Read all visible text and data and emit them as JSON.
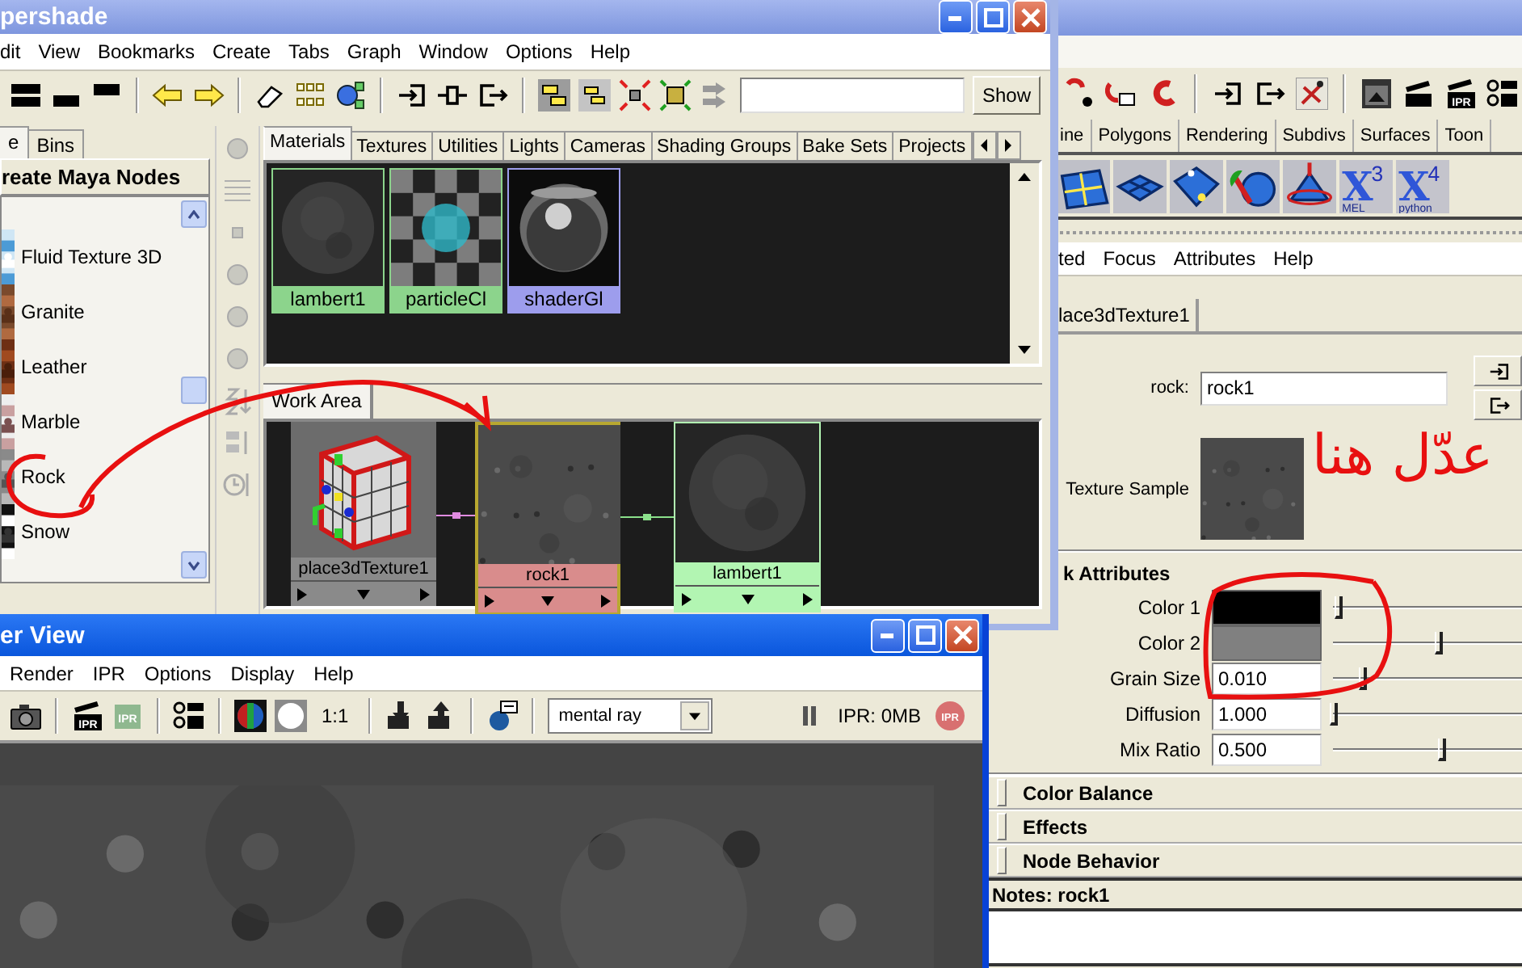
{
  "main_window": {
    "toolbar": [
      {
        "kind": "magnet-dot"
      },
      {
        "kind": "magnet-grid"
      },
      {
        "kind": "magnet"
      },
      {
        "kind": "separator"
      },
      {
        "kind": "input"
      },
      {
        "kind": "output"
      },
      {
        "kind": "history"
      },
      {
        "kind": "separator"
      },
      {
        "kind": "render-frame"
      },
      {
        "kind": "clapboard"
      },
      {
        "kind": "clapboard-text",
        "text": "IPR"
      },
      {
        "kind": "render-settings"
      }
    ],
    "shelf_tabs": [
      "ine",
      "Polygons",
      "Rendering",
      "Subdivs",
      "Surfaces",
      "Toon"
    ],
    "shelf": [
      {
        "kind": "grid-plane"
      },
      {
        "kind": "plane"
      },
      {
        "kind": "plane-points"
      },
      {
        "kind": "sphere-arrow"
      },
      {
        "kind": "cone"
      },
      {
        "kind": "script",
        "letter": "X",
        "sup": "3",
        "sub": "MEL"
      },
      {
        "kind": "script",
        "letter": "X",
        "sup": "4",
        "sub": "python"
      }
    ]
  },
  "attribute_editor": {
    "menu": [
      "ted",
      "Focus",
      "Attributes",
      "Help"
    ],
    "tab": "lace3dTexture1",
    "name_label": "rock:",
    "name_value": "rock1",
    "sample_label": "Texture Sample",
    "section": "k Attributes",
    "attributes": [
      {
        "kind": "color",
        "label": "Color 1",
        "color": "#000000",
        "level": 0.02
      },
      {
        "kind": "color",
        "label": "Color 2",
        "color": "#808080",
        "level": 0.5
      },
      {
        "kind": "number",
        "label": "Grain Size",
        "value": "0.010",
        "level": 0.14
      },
      {
        "kind": "number",
        "label": "Diffusion",
        "value": "1.000",
        "level": 0.0
      },
      {
        "kind": "number",
        "label": "Mix Ratio",
        "value": "0.500",
        "level": 0.52
      }
    ],
    "collapsed_sections": [
      "Color Balance",
      "Effects",
      "Node Behavior"
    ],
    "notes": "Notes:  rock1"
  },
  "hypershade": {
    "title": "pershade",
    "menu": [
      "dit",
      "View",
      "Bookmarks",
      "Create",
      "Tabs",
      "Graph",
      "Window",
      "Options",
      "Help"
    ],
    "toolbar": [
      {
        "kind": "layout-a"
      },
      {
        "kind": "layout-b"
      },
      {
        "kind": "layout-c"
      },
      {
        "kind": "separator"
      },
      {
        "kind": "arrow-left"
      },
      {
        "kind": "arrow-right"
      },
      {
        "kind": "separator"
      },
      {
        "kind": "eraser"
      },
      {
        "kind": "node-grid"
      },
      {
        "kind": "network"
      },
      {
        "kind": "separator"
      },
      {
        "kind": "input"
      },
      {
        "kind": "input-output"
      },
      {
        "kind": "output"
      },
      {
        "kind": "separator"
      },
      {
        "kind": "toggle"
      },
      {
        "kind": "toggle-small"
      },
      {
        "kind": "collapse"
      },
      {
        "kind": "expand"
      },
      {
        "kind": "fan"
      },
      {
        "kind": "field"
      },
      {
        "kind": "button",
        "label": "Show"
      }
    ],
    "left_tabs": [
      {
        "label": "e",
        "selected": true
      },
      {
        "label": "Bins",
        "selected": false
      }
    ],
    "panel_title": "reate Maya Nodes",
    "nodes": [
      "Fluid Texture 3D",
      "Granite",
      "Leather",
      "Marble",
      "Rock",
      "Snow"
    ],
    "side_tools": [
      {
        "kind": "sphere-small"
      },
      {
        "kind": "grid"
      },
      {
        "kind": "dot"
      },
      {
        "kind": "sphere-small"
      },
      {
        "kind": "sphere-small"
      },
      {
        "kind": "sphere-small"
      },
      {
        "kind": "sort-az"
      },
      {
        "kind": "sort-type"
      },
      {
        "kind": "sort-time"
      }
    ],
    "tabs": [
      {
        "label": "Materials",
        "selected": true
      },
      {
        "label": "Textures",
        "selected": false
      },
      {
        "label": "Utilities",
        "selected": false
      },
      {
        "label": "Lights",
        "selected": false
      },
      {
        "label": "Cameras",
        "selected": false
      },
      {
        "label": "Shading Groups",
        "selected": false
      },
      {
        "label": "Bake Sets",
        "selected": false
      },
      {
        "label": "Projects",
        "selected": false
      }
    ],
    "swatches": [
      {
        "label": "lambert1",
        "kind": "lambert"
      },
      {
        "label": "particleCl",
        "kind": "particle"
      },
      {
        "label": "shaderGl",
        "kind": "glow"
      }
    ],
    "work_area": {
      "tab": "Work Area",
      "nodes": [
        {
          "label": "place3dTexture1",
          "kind": "place3d"
        },
        {
          "label": "rock1",
          "kind": "texture"
        },
        {
          "label": "lambert1",
          "kind": "material"
        }
      ]
    }
  },
  "render_view": {
    "title": "er View",
    "menu": [
      "Render",
      "IPR",
      "Options",
      "Display",
      "Help"
    ],
    "toolbar": [
      {
        "kind": "camera"
      },
      {
        "kind": "separator"
      },
      {
        "kind": "clapboard-text",
        "text": "IPR"
      },
      {
        "kind": "ipr-green",
        "text": "IPR"
      },
      {
        "kind": "separator"
      },
      {
        "kind": "render-settings"
      },
      {
        "kind": "separator"
      },
      {
        "kind": "rgb"
      },
      {
        "kind": "circle"
      },
      {
        "kind": "text",
        "text": "1:1"
      },
      {
        "kind": "separator"
      },
      {
        "kind": "down"
      },
      {
        "kind": "up"
      },
      {
        "kind": "separator"
      },
      {
        "kind": "log"
      },
      {
        "kind": "separator"
      },
      {
        "kind": "dropdown",
        "value": "mental ray"
      }
    ],
    "status": [
      {
        "kind": "pause"
      },
      {
        "kind": "text",
        "text": "IPR: 0MB"
      },
      {
        "kind": "ipr-stop",
        "text": "IPR"
      }
    ]
  },
  "annotation": {
    "note": "عدّل هنا"
  }
}
